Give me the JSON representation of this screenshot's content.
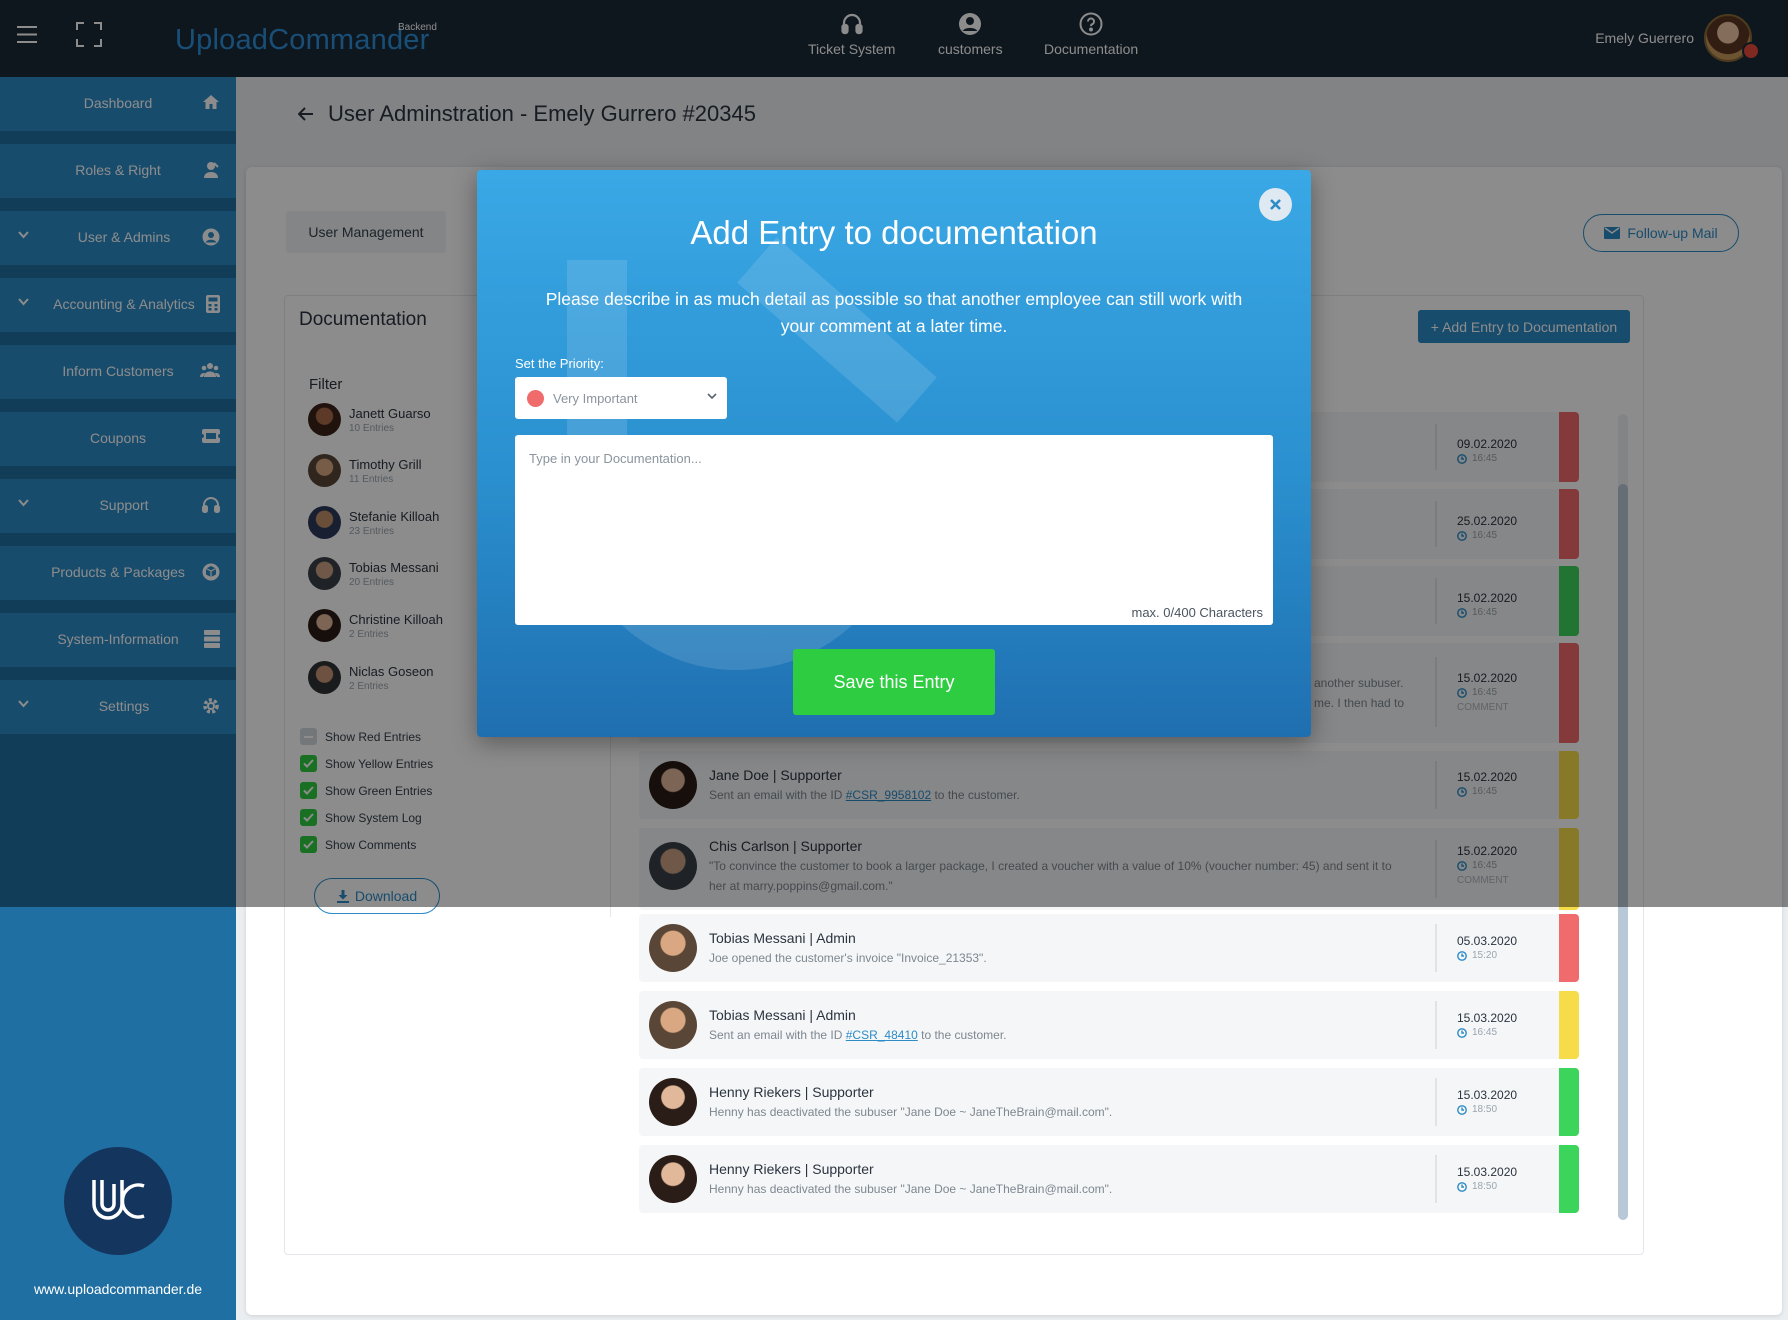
{
  "topbar": {
    "logo": "UploadCommander",
    "logo_sup": "Backend",
    "nav": [
      {
        "label": "Ticket System",
        "icon": "headset-icon"
      },
      {
        "label": "customers",
        "icon": "user-circle-icon"
      },
      {
        "label": "Documentation",
        "icon": "question-circle-icon"
      }
    ],
    "user_name": "Emely Guerrero"
  },
  "sidebar": {
    "items": [
      {
        "label": "Dashboard",
        "icon": "home-icon",
        "expandable": false
      },
      {
        "label": "Roles & Right",
        "icon": "user-tie-icon",
        "expandable": false
      },
      {
        "label": "User & Admins",
        "icon": "user-circle-icon",
        "expandable": true
      },
      {
        "label": "Accounting & Analytics",
        "icon": "calculator-icon",
        "expandable": true
      },
      {
        "label": "Inform Customers",
        "icon": "users-icon",
        "expandable": false
      },
      {
        "label": "Coupons",
        "icon": "ticket-icon",
        "expandable": false
      },
      {
        "label": "Support",
        "icon": "headset-icon",
        "expandable": true
      },
      {
        "label": "Products & Packages",
        "icon": "cube-icon",
        "expandable": false
      },
      {
        "label": "System-Information",
        "icon": "server-icon",
        "expandable": false
      },
      {
        "label": "Settings",
        "icon": "gear-icon",
        "expandable": true
      }
    ],
    "url": "www.uploadcommander.de"
  },
  "page": {
    "title": "User Adminstration - Emely Gurrero #20345",
    "tab_user_management": "User Management",
    "follow_up": "Follow-up Mail",
    "doc_title": "Documentation",
    "add_entry": "+ Add Entry to Documentation"
  },
  "filter": {
    "title": "Filter",
    "people": [
      {
        "name": "Janett Guarso",
        "entries": "10 Entries"
      },
      {
        "name": "Timothy Grill",
        "entries": "11 Entries"
      },
      {
        "name": "Stefanie Killoah",
        "entries": "23 Entries"
      },
      {
        "name": "Tobias Messani",
        "entries": "20 Entries"
      },
      {
        "name": "Christine Killoah",
        "entries": "2 Entries"
      },
      {
        "name": "Niclas Goseon",
        "entries": "2 Entries"
      }
    ],
    "checkboxes": [
      {
        "label": "Show Red Entries",
        "checked": false
      },
      {
        "label": "Show Yellow Entries",
        "checked": true
      },
      {
        "label": "Show Green Entries",
        "checked": true
      },
      {
        "label": "Show System Log",
        "checked": true
      },
      {
        "label": "Show Comments",
        "checked": true
      }
    ],
    "download": "Download"
  },
  "entries": [
    {
      "name": "",
      "text": "",
      "date": "09.02.2020",
      "time": "16:45",
      "comment": "",
      "color": "#f06b6b"
    },
    {
      "name": "",
      "text": "",
      "date": "25.02.2020",
      "time": "16:45",
      "comment": "",
      "color": "#f06b6b"
    },
    {
      "name": "",
      "text": "",
      "date": "15.02.2020",
      "time": "16:45",
      "comment": "",
      "color": "#3dd45c"
    },
    {
      "name": "",
      "text": "another subuser. me. I then had to",
      "date": "15.02.2020",
      "time": "16:45",
      "comment": "COMMENT",
      "color": "#f06b6b"
    },
    {
      "name": "Jane Doe | Supporter",
      "text_pre": "Sent an email with the ID ",
      "link": "#CSR_9958102",
      "text_post": " to the customer.",
      "date": "15.02.2020",
      "time": "16:45",
      "comment": "",
      "color": "#f7dc4a"
    },
    {
      "name": "Chis Carlson | Supporter",
      "text": "\"To convince the customer to book a larger package, I created a voucher with a value of 10% (voucher number: 45) and sent it to her at marry.poppins@gmail.com.\"",
      "date": "15.02.2020",
      "time": "16:45",
      "comment": "COMMENT",
      "color": "#f7dc4a"
    },
    {
      "name": "Tobias Messani | Admin",
      "text": "Joe opened the customer's invoice \"Invoice_21353\".",
      "date": "05.03.2020",
      "time": "15:20",
      "comment": "",
      "color": "#f06b6b"
    },
    {
      "name": "Tobias Messani | Admin",
      "text_pre": "Sent an email with the ID ",
      "link": "#CSR_48410",
      "text_post": " to the customer.",
      "date": "15.03.2020",
      "time": "16:45",
      "comment": "",
      "color": "#f7dc4a"
    },
    {
      "name": "Henny Riekers | Supporter",
      "text": "Henny has deactivated the subuser \"Jane Doe ~ JaneTheBrain@mail.com\".",
      "date": "15.03.2020",
      "time": "18:50",
      "comment": "",
      "color": "#3dd45c"
    },
    {
      "name": "Henny Riekers | Supporter",
      "text": "Henny has deactivated the subuser \"Jane Doe ~ JaneTheBrain@mail.com\".",
      "date": "15.03.2020",
      "time": "18:50",
      "comment": "",
      "color": "#3dd45c"
    }
  ],
  "modal": {
    "title": "Add Entry to documentation",
    "description": "Please describe in as much detail as possible so that another employee can still work with your comment at a later time.",
    "priority_label": "Set the Priority:",
    "priority_value": "Very Important",
    "priority_color": "#f06b6b",
    "placeholder": "Type in your Documentation...",
    "char_counter": "max. 0/400 Characters",
    "save": "Save this Entry"
  },
  "colors": {
    "accent": "#2d8bc6",
    "topbar": "#1d2a38",
    "save": "#2ecc40"
  }
}
